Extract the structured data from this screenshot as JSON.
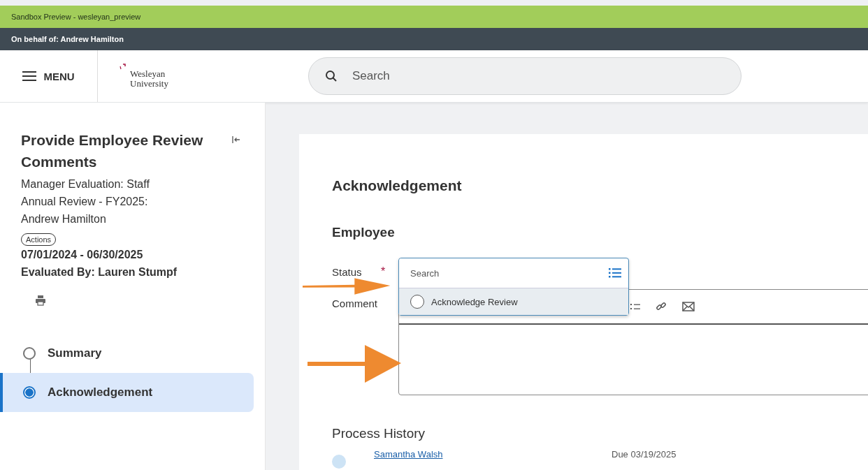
{
  "sandbox_banner": "Sandbox Preview - wesleyan_preview",
  "proxy_banner": "On behalf of: Andrew Hamilton",
  "header": {
    "menu_label": "MENU",
    "logo_text": [
      "Wesleyan",
      "University"
    ],
    "search": {
      "placeholder": "Search"
    }
  },
  "sidebar": {
    "title": "Provide Employee Review Comments",
    "subtitle": "Manager Evaluation: Staff Annual Review - FY2025: Andrew Hamilton",
    "actions_label": "Actions",
    "period": "07/01/2024 - 06/30/2025",
    "evaluated_by": "Evaluated By: Lauren Stumpf",
    "steps": [
      {
        "label": "Summary",
        "selected": false
      },
      {
        "label": "Acknowledgement",
        "selected": true
      }
    ]
  },
  "form": {
    "heading": "Acknowledgement",
    "section": "Employee",
    "status": {
      "label": "Status",
      "required": true,
      "required_mark": "*",
      "placeholder": "Search",
      "options": [
        {
          "label": "Acknowledge Review",
          "checked": false
        }
      ]
    },
    "comment": {
      "label": "Comment"
    },
    "process_history": {
      "heading": "Process History",
      "entries": [
        {
          "name": "Samantha Walsh",
          "due": "Due 03/19/2025"
        }
      ]
    }
  }
}
